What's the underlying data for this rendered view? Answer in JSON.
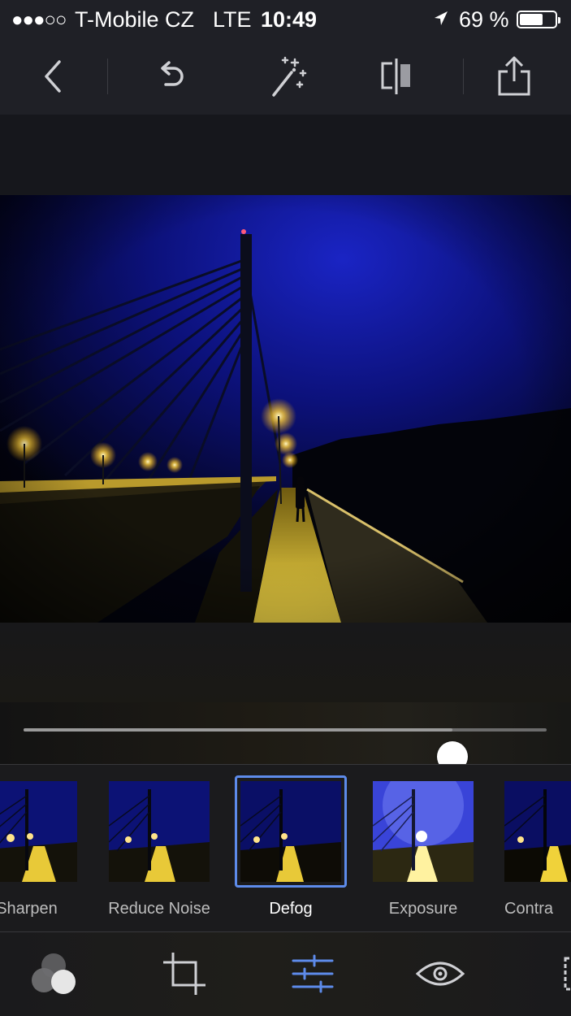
{
  "status_bar": {
    "signal": "●●●○○",
    "carrier": "T-Mobile CZ",
    "network": "LTE",
    "time": "10:49",
    "battery_text": "69 %",
    "battery_level": 0.69
  },
  "toolbar": {
    "icons": [
      "back-icon",
      "undo-icon",
      "magic-wand-icon",
      "compare-icon",
      "share-icon"
    ]
  },
  "adjustment": {
    "slider_value": 0.82
  },
  "presets": [
    {
      "label": "Sharpen",
      "selected": false
    },
    {
      "label": "Reduce Noise",
      "selected": false
    },
    {
      "label": "Defog",
      "selected": true
    },
    {
      "label": "Exposure",
      "selected": false
    },
    {
      "label": "Contra",
      "selected": false
    }
  ],
  "bottom_tabs": {
    "icons": [
      "looks-icon",
      "crop-icon",
      "adjustments-icon",
      "red-eye-icon",
      "frame-icon"
    ],
    "active": "adjustments-icon",
    "accent": "#5d8bea"
  }
}
